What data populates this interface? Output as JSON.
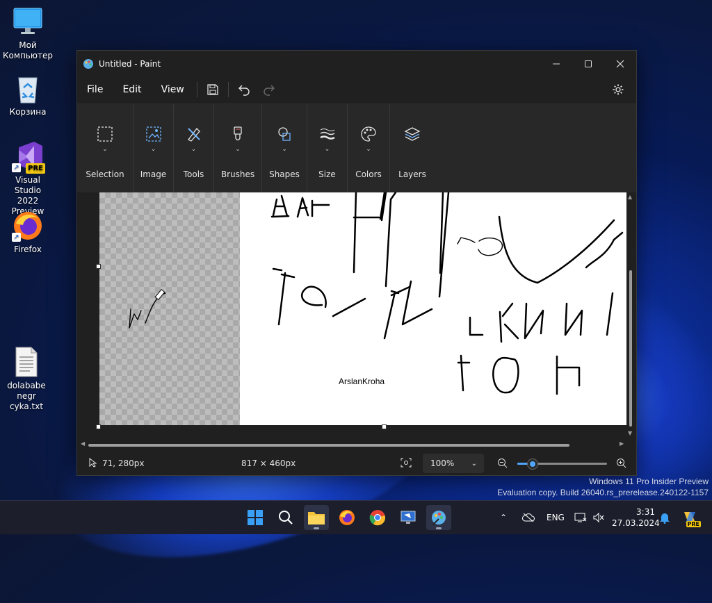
{
  "desktop": {
    "icons": [
      {
        "label_line1": "Мой",
        "label_line2": "Компьютер",
        "icon": "monitor-icon"
      },
      {
        "label_line1": "Корзина",
        "label_line2": "",
        "icon": "recycle-bin-icon"
      },
      {
        "label_line1": "Visual Studio",
        "label_line2": "2022 Preview",
        "icon": "visual-studio-icon",
        "badge": "PRE"
      },
      {
        "label_line1": "Firefox",
        "label_line2": "",
        "icon": "firefox-icon"
      },
      {
        "label_line1": "dolababe",
        "label_line2": "negr cyka.txt",
        "icon": "text-file-icon"
      }
    ]
  },
  "window": {
    "title": "Untitled - Paint",
    "menu": [
      "File",
      "Edit",
      "View"
    ],
    "ribbon": [
      {
        "label": "Selection",
        "icon": "selection-icon"
      },
      {
        "label": "Image",
        "icon": "image-icon"
      },
      {
        "label": "Tools",
        "icon": "tools-icon"
      },
      {
        "label": "Brushes",
        "icon": "brush-icon"
      },
      {
        "label": "Shapes",
        "icon": "shapes-icon"
      },
      {
        "label": "Size",
        "icon": "size-icon"
      },
      {
        "label": "Colors",
        "icon": "palette-icon"
      },
      {
        "label": "Layers",
        "icon": "layers-icon"
      }
    ],
    "canvas_text": "ArslanKroha",
    "status": {
      "cursor_pos": "71, 280px",
      "canvas_size": "817 × 460px",
      "zoom": "100%",
      "zoom_fraction": 0.17
    }
  },
  "watermark": {
    "line1": "Windows 11 Pro Insider Preview",
    "line2": "Evaluation copy. Build 26040.rs_prerelease.240122-1157"
  },
  "taskbar": {
    "language": "ENG",
    "time": "3:31",
    "date": "27.03.2024",
    "copilot_badge": "PRE"
  },
  "colors": {
    "accent": "#4fa6ff",
    "window_bg": "#202020",
    "ribbon_bg": "#282828",
    "taskbar_bg": "#1c1f2b"
  }
}
